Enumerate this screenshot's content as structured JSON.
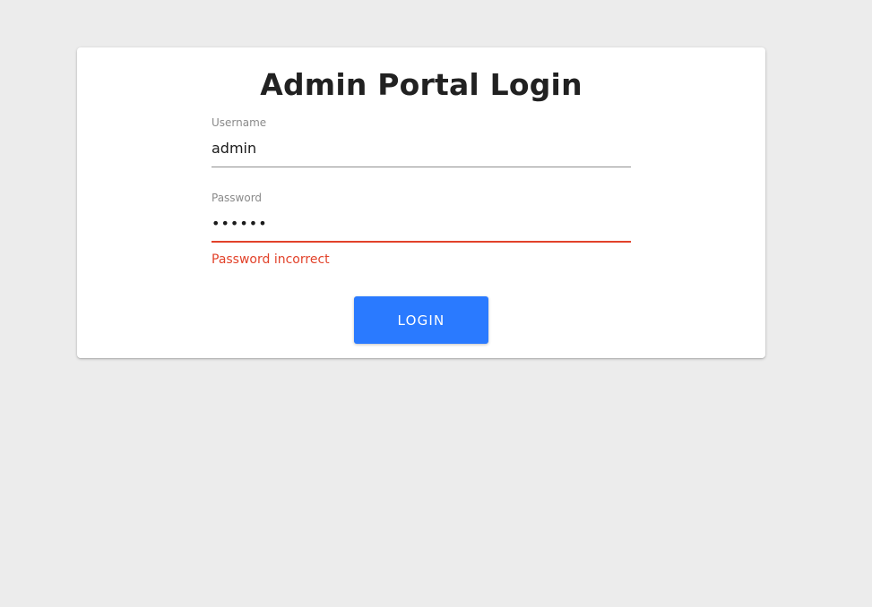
{
  "login": {
    "title": "Admin Portal Login",
    "username": {
      "label": "Username",
      "value": "admin"
    },
    "password": {
      "label": "Password",
      "value": "••••••",
      "error": "Password incorrect"
    },
    "submit_label": "LOGIN"
  },
  "colors": {
    "background": "#ececec",
    "card": "#ffffff",
    "accent": "#2a7aff",
    "error": "#e2422a"
  }
}
